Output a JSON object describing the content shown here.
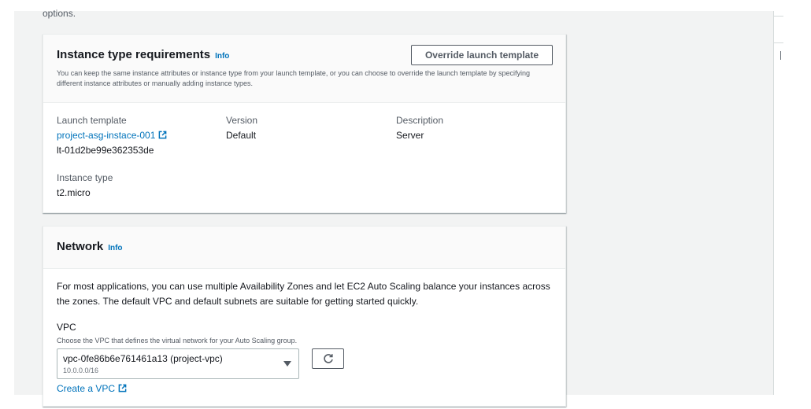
{
  "top_text": "options.",
  "instance_requirements": {
    "title": "Instance type requirements",
    "info": "Info",
    "description": "You can keep the same instance attributes or instance type from your launch template, or you can choose to override the launch template by specifying different instance attributes or manually adding instance types.",
    "override_button": "Override launch template",
    "launch_template_label": "Launch template",
    "launch_template_name": "project-asg-instace-001",
    "launch_template_id": "lt-01d2be99e362353de",
    "version_label": "Version",
    "version_value": "Default",
    "description_label": "Description",
    "description_value": "Server",
    "instance_type_label": "Instance type",
    "instance_type_value": "t2.micro"
  },
  "network": {
    "title": "Network",
    "info": "Info",
    "description": "For most applications, you can use multiple Availability Zones and let EC2 Auto Scaling balance your instances across the zones. The default VPC and default subnets are suitable for getting started quickly.",
    "vpc_label": "VPC",
    "vpc_hint": "Choose the VPC that defines the virtual network for your Auto Scaling group.",
    "vpc_selected": "vpc-0fe86b6e761461a13 (project-vpc)",
    "vpc_cidr": "10.0.0.0/16",
    "create_vpc": "Create a VPC"
  },
  "icons": {
    "external_link": "external-link-icon",
    "refresh": "refresh-icon",
    "caret": "caret-down-icon"
  },
  "colors": {
    "link": "#0073bb",
    "background": "#f2f3f3",
    "header_bg": "#fafafa"
  }
}
